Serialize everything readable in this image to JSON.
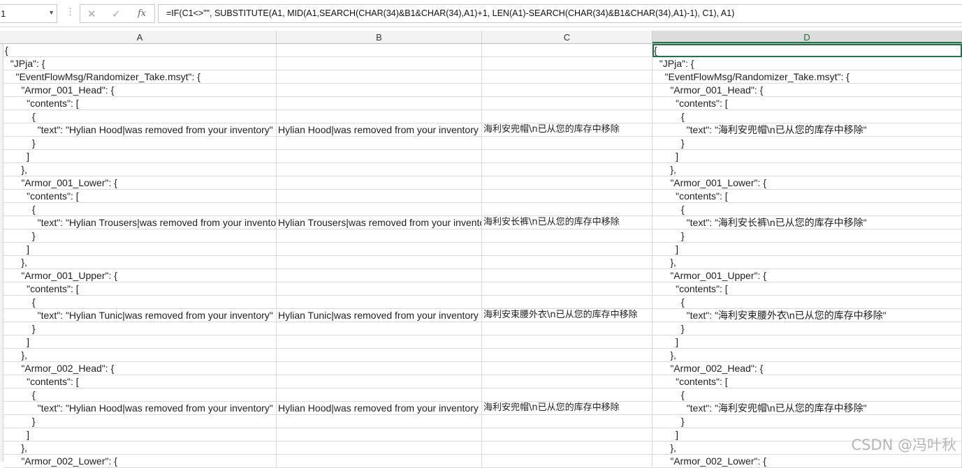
{
  "name_box": {
    "value": "1",
    "dropdown_icon": "caret-down-icon"
  },
  "formula_bar": {
    "separator": "⋮",
    "cancel_icon": "✕",
    "enter_icon": "✓",
    "function_icon": "fx",
    "formula": "=IF(C1<>\"\", SUBSTITUTE(A1, MID(A1,SEARCH(CHAR(34)&B1&CHAR(34),A1)+1, LEN(A1)-SEARCH(CHAR(34)&B1&CHAR(34),A1)-1), C1), A1)"
  },
  "columns": [
    "A",
    "B",
    "C",
    "D"
  ],
  "active_column": "D",
  "rows": [
    {
      "A": "{",
      "B": "",
      "C": "",
      "D": "{"
    },
    {
      "A": "  \"JPja\": {",
      "B": "",
      "C": "",
      "D": "  \"JPja\": {"
    },
    {
      "A": "    \"EventFlowMsg/Randomizer_Take.msyt\": {",
      "B": "",
      "C": "",
      "D": "    \"EventFlowMsg/Randomizer_Take.msyt\": {"
    },
    {
      "A": "      \"Armor_001_Head\": {",
      "B": "",
      "C": "",
      "D": "      \"Armor_001_Head\": {"
    },
    {
      "A": "        \"contents\": [",
      "B": "",
      "C": "",
      "D": "        \"contents\": ["
    },
    {
      "A": "          {",
      "B": "",
      "C": "",
      "D": "          {"
    },
    {
      "A": "            \"text\": \"Hylian Hood|was removed from your inventory\"",
      "B": "Hylian Hood|was removed from your inventory",
      "C": "海利安兜帽\\n已从您的库存中移除",
      "D": "            \"text\": \"海利安兜帽\\n已从您的库存中移除\""
    },
    {
      "A": "          }",
      "B": "",
      "C": "",
      "D": "          }"
    },
    {
      "A": "        ]",
      "B": "",
      "C": "",
      "D": "        ]"
    },
    {
      "A": "      },",
      "B": "",
      "C": "",
      "D": "      },"
    },
    {
      "A": "      \"Armor_001_Lower\": {",
      "B": "",
      "C": "",
      "D": "      \"Armor_001_Lower\": {"
    },
    {
      "A": "        \"contents\": [",
      "B": "",
      "C": "",
      "D": "        \"contents\": ["
    },
    {
      "A": "          {",
      "B": "",
      "C": "",
      "D": "          {"
    },
    {
      "A": "            \"text\": \"Hylian Trousers|was removed from your inventory\"",
      "B": "Hylian Trousers|was removed from your inventory",
      "C": "海利安长裤\\n已从您的库存中移除",
      "D": "            \"text\": \"海利安长裤\\n已从您的库存中移除\""
    },
    {
      "A": "          }",
      "B": "",
      "C": "",
      "D": "          }"
    },
    {
      "A": "        ]",
      "B": "",
      "C": "",
      "D": "        ]"
    },
    {
      "A": "      },",
      "B": "",
      "C": "",
      "D": "      },"
    },
    {
      "A": "      \"Armor_001_Upper\": {",
      "B": "",
      "C": "",
      "D": "      \"Armor_001_Upper\": {"
    },
    {
      "A": "        \"contents\": [",
      "B": "",
      "C": "",
      "D": "        \"contents\": ["
    },
    {
      "A": "          {",
      "B": "",
      "C": "",
      "D": "          {"
    },
    {
      "A": "            \"text\": \"Hylian Tunic|was removed from your inventory\"",
      "B": "Hylian Tunic|was removed from your inventory",
      "C": "海利安束腰外衣\\n已从您的库存中移除",
      "D": "            \"text\": \"海利安束腰外衣\\n已从您的库存中移除\""
    },
    {
      "A": "          }",
      "B": "",
      "C": "",
      "D": "          }"
    },
    {
      "A": "        ]",
      "B": "",
      "C": "",
      "D": "        ]"
    },
    {
      "A": "      },",
      "B": "",
      "C": "",
      "D": "      },"
    },
    {
      "A": "      \"Armor_002_Head\": {",
      "B": "",
      "C": "",
      "D": "      \"Armor_002_Head\": {"
    },
    {
      "A": "        \"contents\": [",
      "B": "",
      "C": "",
      "D": "        \"contents\": ["
    },
    {
      "A": "          {",
      "B": "",
      "C": "",
      "D": "          {"
    },
    {
      "A": "            \"text\": \"Hylian Hood|was removed from your inventory\"",
      "B": "Hylian Hood|was removed from your inventory",
      "C": "海利安兜帽\\n已从您的库存中移除",
      "D": "            \"text\": \"海利安兜帽\\n已从您的库存中移除\""
    },
    {
      "A": "          }",
      "B": "",
      "C": "",
      "D": "          }"
    },
    {
      "A": "        ]",
      "B": "",
      "C": "",
      "D": "        ]"
    },
    {
      "A": "      },",
      "B": "",
      "C": "",
      "D": "      },"
    },
    {
      "A": "      \"Armor_002_Lower\": {",
      "B": "",
      "C": "",
      "D": "      \"Armor_002_Lower\": {"
    }
  ],
  "watermark": "CSDN @冯叶秋",
  "colors": {
    "accent": "#217346",
    "header_bg": "#f3f3f3",
    "gridline": "#dadada"
  }
}
